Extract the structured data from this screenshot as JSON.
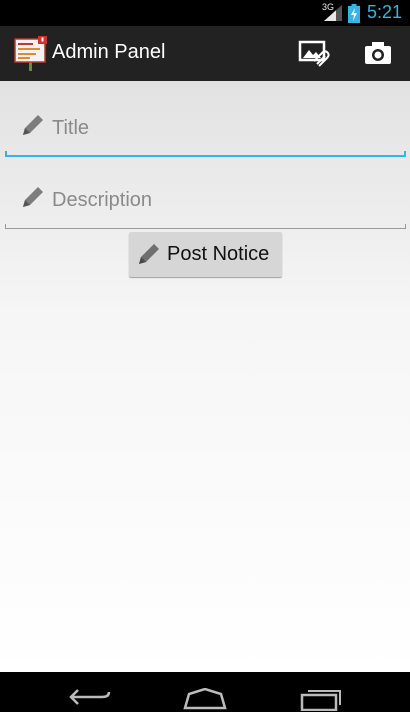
{
  "status_bar": {
    "network": "3G",
    "time": "5:21",
    "icons": [
      "signal-icon",
      "battery-charging-icon"
    ]
  },
  "action_bar": {
    "title": "Admin Panel",
    "app_icon": "notice-board-icon",
    "actions": [
      {
        "icon": "attach-image-icon"
      },
      {
        "icon": "camera-icon"
      }
    ]
  },
  "form": {
    "title_placeholder": "Title",
    "description_placeholder": "Description",
    "post_button_label": "Post Notice",
    "field_icon": "pencil-icon"
  },
  "nav_bar": {
    "icons": [
      "back-icon",
      "home-icon",
      "recents-icon"
    ]
  },
  "colors": {
    "accent": "#33b5e5",
    "action_bar": "#222222",
    "button": "#d6d6d6"
  }
}
